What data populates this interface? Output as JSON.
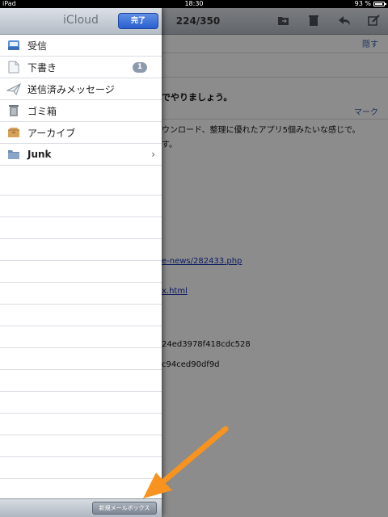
{
  "status_bar": {
    "device": "iPad",
    "time": "18:30",
    "battery": "93 %",
    "battery_level": 0.93
  },
  "mail": {
    "counter": "224/350",
    "hide_label": "隠す",
    "subject": "でやりましょう。",
    "mark_label": "マーク",
    "body_lines": [
      "ウンロード、整理に優れたアプリ5個みたいな感じで。",
      "す。"
    ],
    "link1": "e-news/282433.php",
    "link2": "x.html",
    "hash1": "24ed3978f418cdc528",
    "hash2": "c94ced90df9d"
  },
  "panel": {
    "title": "iCloud",
    "done_label": "完了",
    "mailboxes": [
      {
        "label": "受信",
        "icon": "inbox-icon"
      },
      {
        "label": "下書き",
        "icon": "drafts-icon",
        "badge": "1"
      },
      {
        "label": "送信済みメッセージ",
        "icon": "sent-icon"
      },
      {
        "label": "ゴミ箱",
        "icon": "trash-icon"
      },
      {
        "label": "アーカイブ",
        "icon": "archive-icon"
      },
      {
        "label": "Junk",
        "icon": "folder-icon"
      }
    ],
    "new_mailbox_label": "新規メールボックス"
  },
  "colors": {
    "accent": "#2a5fd0",
    "annotation_arrow": "#f7931e"
  }
}
